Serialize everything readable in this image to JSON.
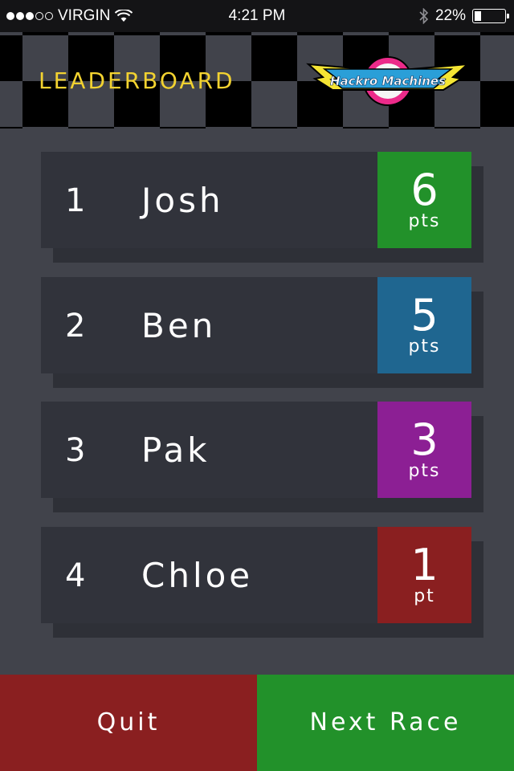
{
  "status_bar": {
    "carrier": "VIRGIN",
    "time": "4:21 PM",
    "battery_text": "22%",
    "battery_level": 0.22,
    "signal_bars": 3,
    "signal_total": 5,
    "icons": [
      "wifi-icon",
      "bluetooth-icon",
      "battery-icon"
    ]
  },
  "header": {
    "title": "LEADERBOARD",
    "logo_text": "Hackro Machines"
  },
  "leaderboard": [
    {
      "rank": "1",
      "name": "Josh",
      "points": "6",
      "unit": "pts",
      "color": "#22912a"
    },
    {
      "rank": "2",
      "name": "Ben",
      "points": "5",
      "unit": "pts",
      "color": "#1f6690"
    },
    {
      "rank": "3",
      "name": "Pak",
      "points": "3",
      "unit": "pts",
      "color": "#8c1f94"
    },
    {
      "rank": "4",
      "name": "Chloe",
      "points": "1",
      "unit": "pt",
      "color": "#8a1f20"
    }
  ],
  "actions": {
    "quit_label": "Quit",
    "next_label": "Next Race",
    "quit_color": "#8a1f20",
    "next_color": "#22912a"
  },
  "colors": {
    "background": "#41434b",
    "accent_title": "#f2d230"
  }
}
